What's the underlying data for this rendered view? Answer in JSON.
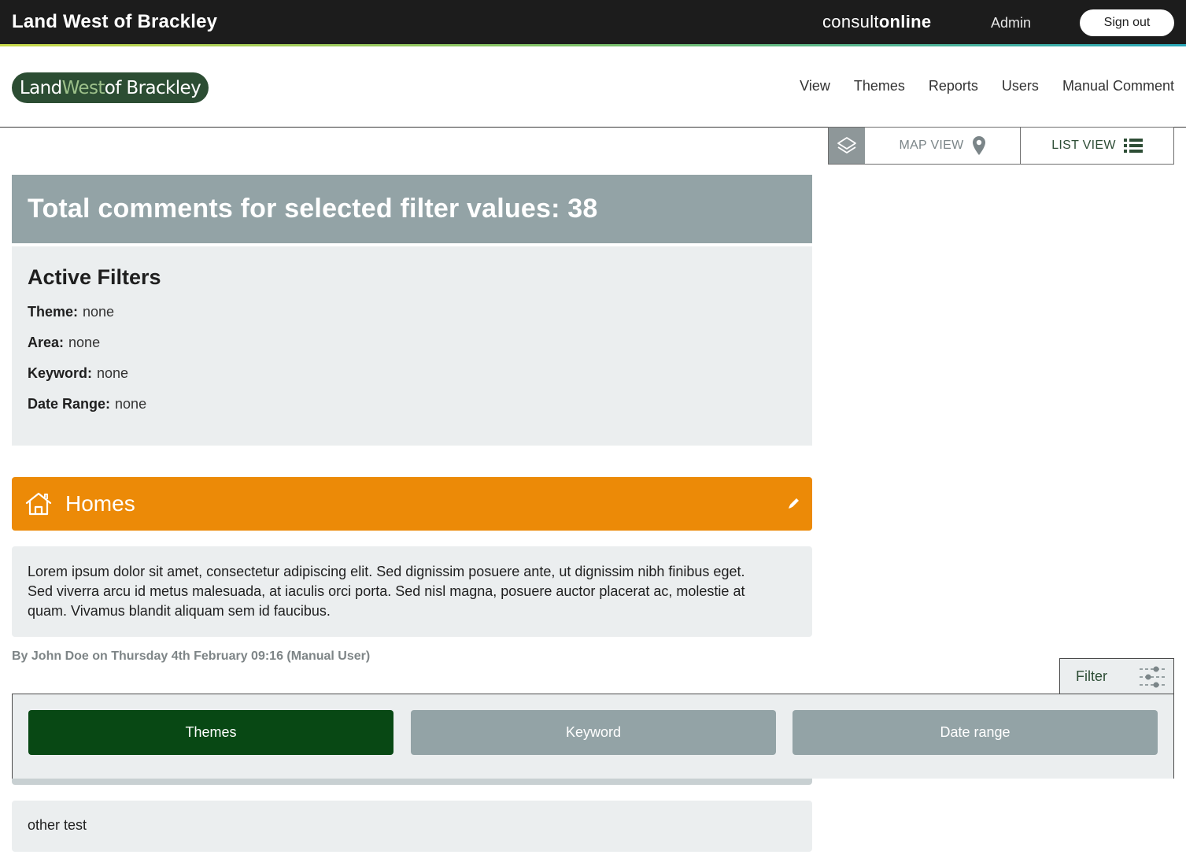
{
  "topbar": {
    "site_title": "Land West of Brackley",
    "brand_light": "consult",
    "brand_bold": "online",
    "admin_label": "Admin",
    "signout_label": "Sign out"
  },
  "header": {
    "logo": {
      "part1": "Land ",
      "part2": "West",
      "part3": " of Brackley"
    },
    "nav": [
      "View",
      "Themes",
      "Reports",
      "Users",
      "Manual Comment"
    ]
  },
  "view_toggle": {
    "map_label": "MAP VIEW",
    "list_label": "LIST VIEW"
  },
  "summary": {
    "total_text": "Total comments for selected filter values: 38"
  },
  "active_filters": {
    "title": "Active Filters",
    "rows": [
      {
        "label": "Theme:",
        "value": "none"
      },
      {
        "label": "Area:",
        "value": "none"
      },
      {
        "label": "Keyword:",
        "value": "none"
      },
      {
        "label": "Date Range:",
        "value": "none"
      }
    ]
  },
  "theme_card": {
    "name": "Homes",
    "color": "#ec8a07",
    "icon": "house-icon",
    "comment": "Lorem ipsum dolor sit amet, consectetur adipiscing elit. Sed dignissim posuere ante, ut dignissim nibh finibus eget. Sed viverra arcu id metus malesuada, at iaculis orci porta. Sed nisl magna, posuere auctor placerat ac, molestie at quam. Vivamus blandit aliquam sem id faucibus.",
    "byline": "By John Doe on Thursday 4th February 09:16 (Manual User)"
  },
  "filter_drawer": {
    "tab_label": "Filter",
    "buttons": [
      {
        "label": "Themes",
        "active": true
      },
      {
        "label": "Keyword",
        "active": false
      },
      {
        "label": "Date range",
        "active": false
      }
    ]
  },
  "other_comment": {
    "text": "other test"
  },
  "colors": {
    "topbar": "#1c1c1c",
    "brand_green": "#2c4d33",
    "active_button": "#084814",
    "grey_panel": "#93a3a6",
    "light_panel": "#ebeeef"
  }
}
